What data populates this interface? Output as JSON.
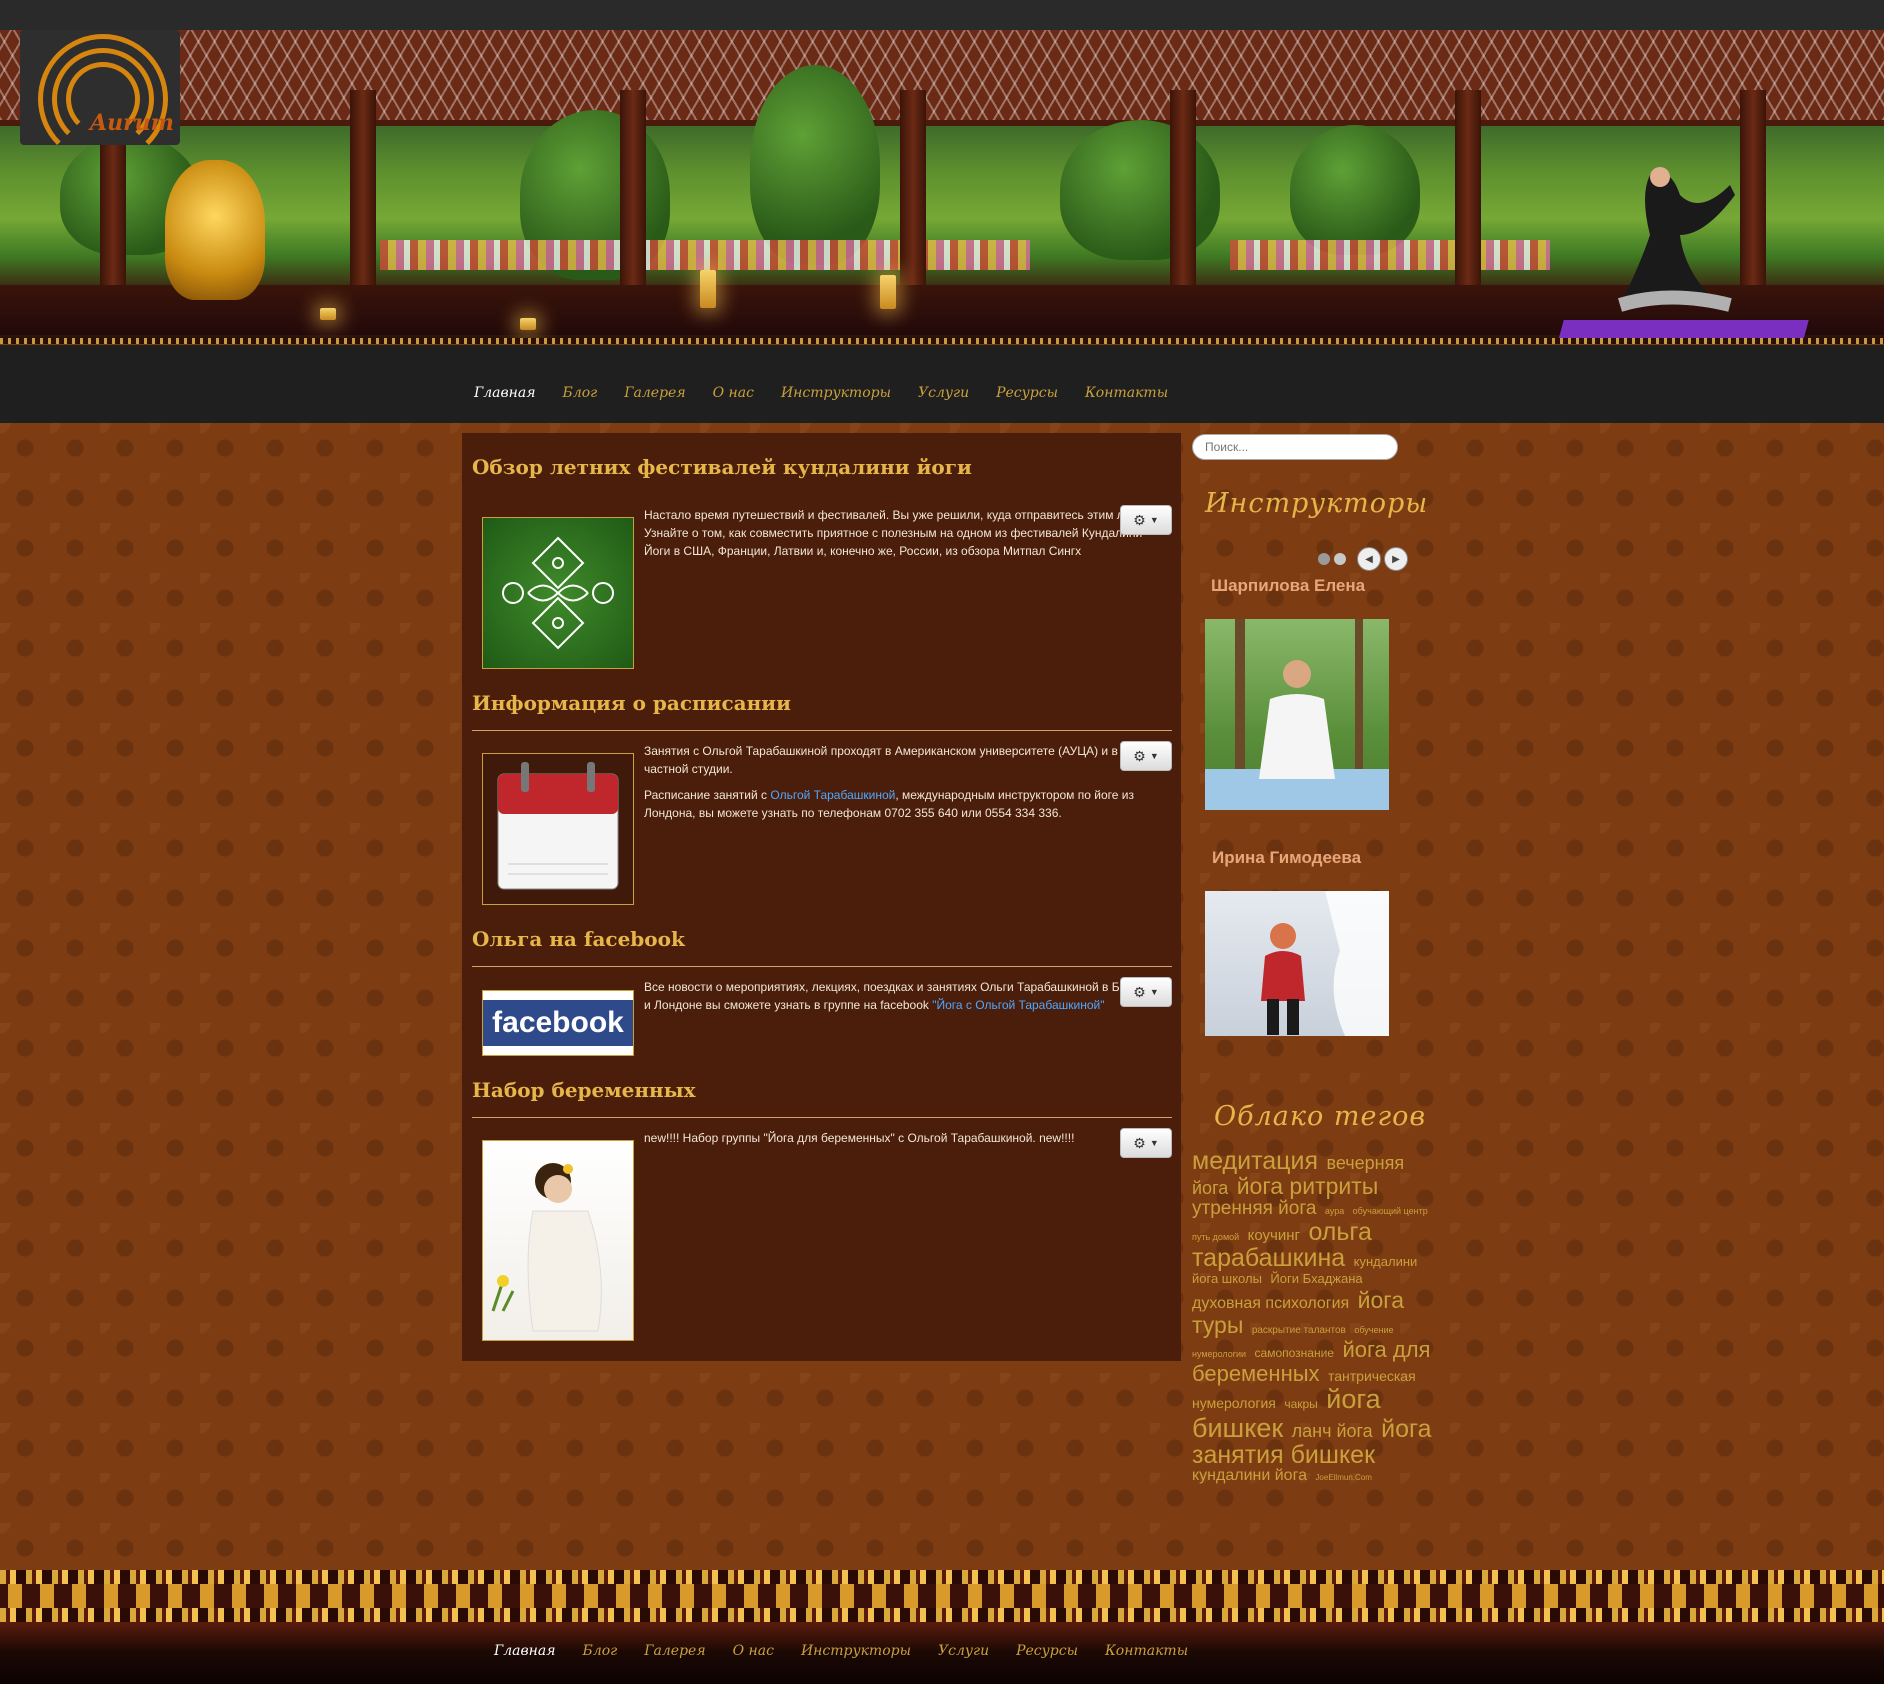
{
  "logo": {
    "text": "Aurum"
  },
  "nav": {
    "items": [
      "Главная",
      "Блог",
      "Галерея",
      "О нас",
      "Инструкторы",
      "Услуги",
      "Ресурсы",
      "Контакты"
    ]
  },
  "posts": [
    {
      "title": "Обзор летних фестивалей кундалини йоги",
      "paragraphs": [
        "Настало время путешествий и фестивалей. Вы уже решили, куда отправитесь этим летом? Узнайте о том, как совместить приятное с полезным на одном из фестивалей Кундалини Йоги в США, Франции, Латвии и, конечно же, России, из обзора Митпал Сингх"
      ],
      "image": "mandala-on-grass"
    },
    {
      "title": "Информация о расписании",
      "paragraphs": [
        "Занятия с Ольгой Тарабашкиной проходят в Американском университете (АУЦА) и в ее частной студии."
      ],
      "p2_before": "Расписание занятий с ",
      "p2_link": "Ольгой Тарабашкиной",
      "p2_after": ", международным инструктором по йоге из Лондона, вы можете узнать по телефонам 0702 355 640 или 0554 334 336.",
      "image": "calendar-icon"
    },
    {
      "title": "Ольга на facebook",
      "p_before": "Все новости о мероприятиях, лекциях, поездках и занятиях Ольги Тарабашкиной в Бишкеке и Лондоне вы сможете узнать в группе на facebook ",
      "p_link": "\"Йога с Ольгой Тарабашкиной\"",
      "image": "facebook-logo",
      "logo_text": "facebook"
    },
    {
      "title": "Набор беременных",
      "paragraphs": [
        "new!!!! Набор группы \"Йога для беременных\" с Ольгой Тарабашкиной. new!!!!"
      ],
      "image": "pregnant-woman-photo"
    }
  ],
  "sidebar": {
    "search_placeholder": "Поиск...",
    "instructors_heading": "Инструкторы",
    "instructors": [
      {
        "name": "Шарпилова Елена",
        "photo": "woman-meditating-in-park"
      },
      {
        "name": "Ирина Гимодеева",
        "photo": "woman-in-snow"
      }
    ],
    "tags_heading": "Облако тегов",
    "tags": [
      {
        "text": "медитация",
        "size": 25
      },
      {
        "text": "вечерняя йога",
        "size": 18
      },
      {
        "text": "йога ритриты",
        "size": 23
      },
      {
        "text": "утренняя йога",
        "size": 19
      },
      {
        "text": "аура",
        "size": 9
      },
      {
        "text": "обучающий центр путь домой",
        "size": 9
      },
      {
        "text": "коучинг",
        "size": 15
      },
      {
        "text": "ольга тарабашкина",
        "size": 25
      },
      {
        "text": "кундалини йога школы",
        "size": 13
      },
      {
        "text": "Йоги Бхаджана",
        "size": 13
      },
      {
        "text": "духовная психология",
        "size": 16
      },
      {
        "text": "йога туры",
        "size": 23
      },
      {
        "text": "раскрытие талантов",
        "size": 10
      },
      {
        "text": "обучение нумерологии",
        "size": 9
      },
      {
        "text": "самопознание",
        "size": 12
      },
      {
        "text": "йога для беременных",
        "size": 22
      },
      {
        "text": "тантрическая нумерология",
        "size": 14
      },
      {
        "text": "чакры",
        "size": 12
      },
      {
        "text": "йога бишкек",
        "size": 27
      },
      {
        "text": "ланч йога",
        "size": 18
      },
      {
        "text": "йога занятия бишкек",
        "size": 25
      },
      {
        "text": "кундалини йога",
        "size": 16
      },
      {
        "text": "JoeEllmun.Com",
        "size": 8
      }
    ]
  },
  "footer_nav": {
    "items": [
      "Главная",
      "Блог",
      "Галерея",
      "О нас",
      "Инструкторы",
      "Услуги",
      "Ресурсы",
      "Контакты"
    ]
  },
  "colors": {
    "accent": "#e6b64a",
    "link": "#4fa8ff",
    "content_bg": "#4a1e0b",
    "page_bg": "#7e3c12"
  }
}
